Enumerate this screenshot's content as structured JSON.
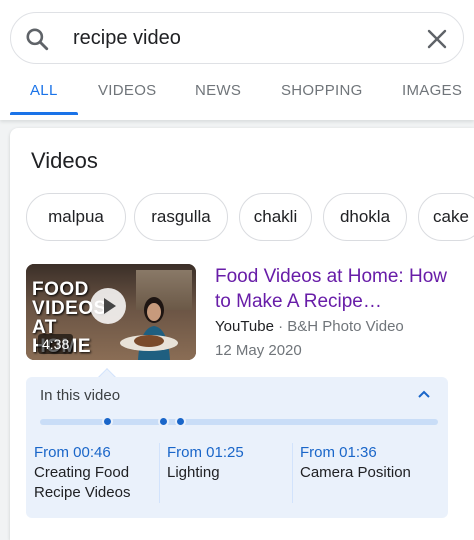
{
  "search": {
    "query": "recipe video"
  },
  "tabs": [
    {
      "label": "ALL",
      "active": true
    },
    {
      "label": "VIDEOS"
    },
    {
      "label": "NEWS"
    },
    {
      "label": "SHOPPING"
    },
    {
      "label": "IMAGES"
    }
  ],
  "videos": {
    "title": "Videos",
    "chips": [
      "malpua",
      "rasgulla",
      "chakli",
      "dhokla",
      "cake"
    ],
    "result": {
      "thumbnail_text": "FOOD VIDEOS AT HOME",
      "duration": "4:38",
      "title": "Food Videos at Home: How to Make A Recipe…",
      "source": "YouTube",
      "separator": "·",
      "channel": "B&H Photo Video",
      "date": "12 May 2020"
    },
    "moments": {
      "header": "In this video",
      "segments": [
        {
          "time": "From 00:46",
          "label": "Creating Food Recipe Videos"
        },
        {
          "time": "From 01:25",
          "label": "Lighting"
        },
        {
          "time": "From 01:36",
          "label": "Camera Position"
        }
      ]
    }
  },
  "colors": {
    "accent": "#1a73e8",
    "visited_link": "#681da8",
    "moments_bg": "#eaf1fb"
  }
}
